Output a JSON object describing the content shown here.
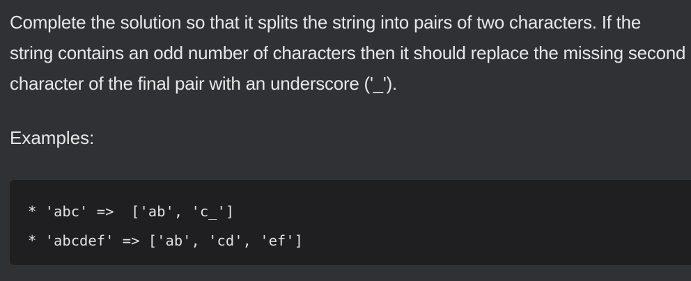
{
  "description": {
    "text": "Complete the solution so that it splits the string into pairs of two characters. If the string contains an odd number of characters then it should replace the missing second character of the final pair with an underscore ('_')."
  },
  "examples": {
    "heading": "Examples:",
    "lines": [
      "* 'abc' =>  ['ab', 'c_']",
      "* 'abcdef' => ['ab', 'cd', 'ef']"
    ]
  },
  "colors": {
    "background": "#303134",
    "code_background": "#1f1f21",
    "text": "#e7e7e8"
  }
}
